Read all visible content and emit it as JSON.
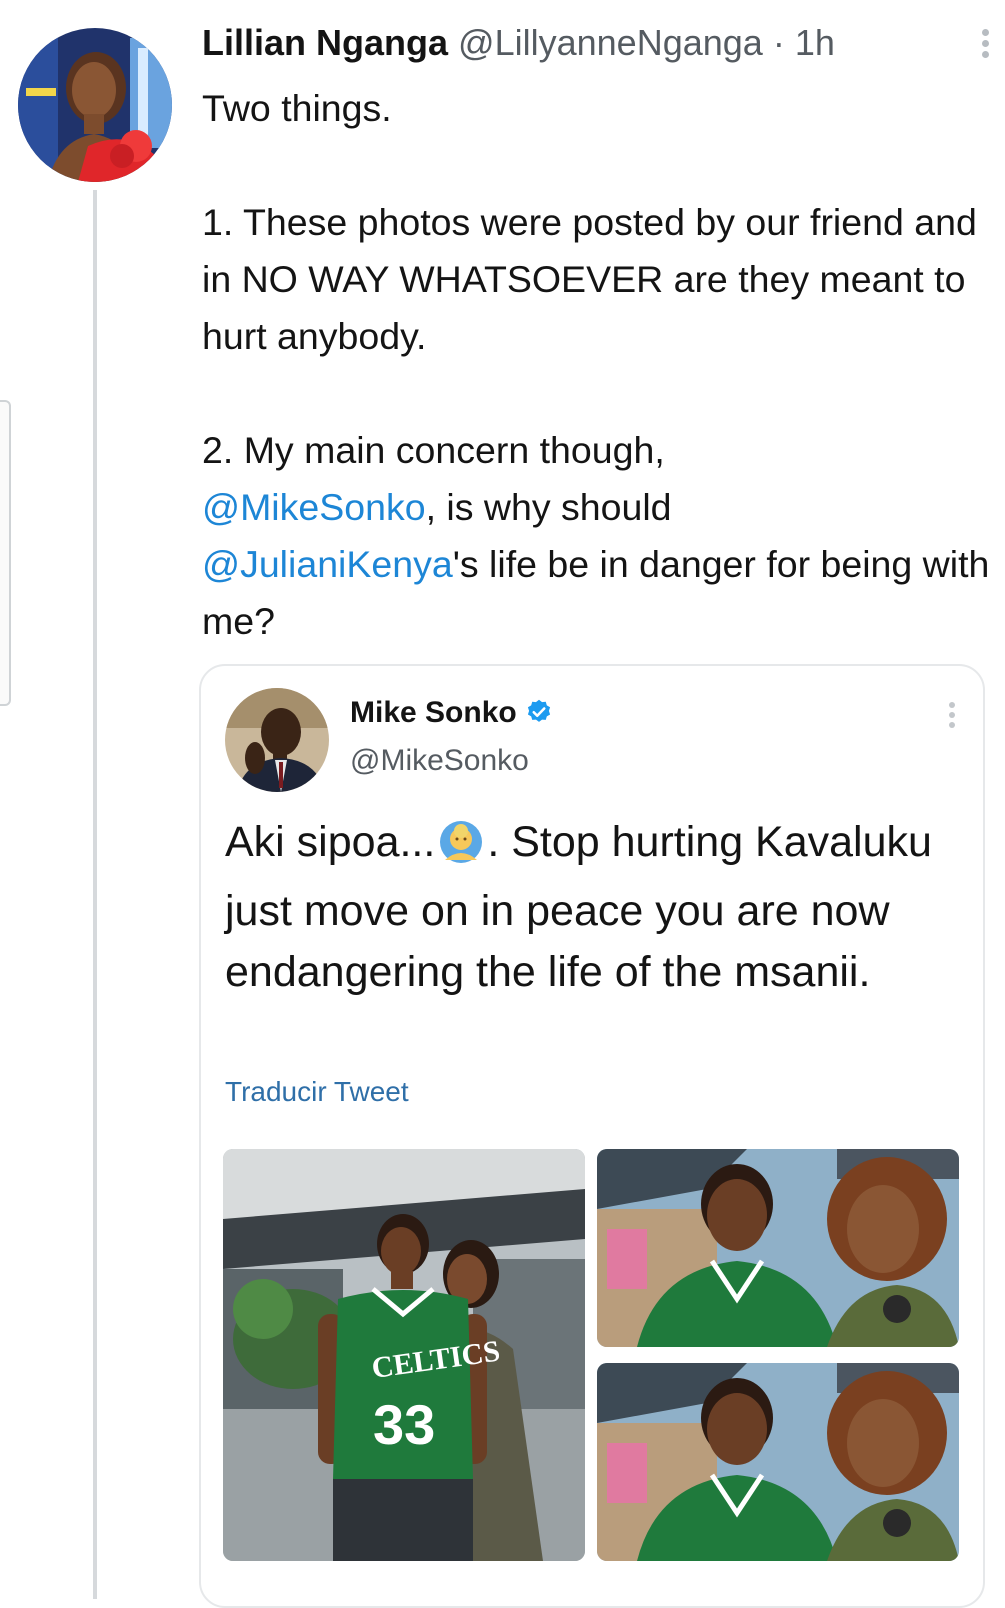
{
  "tweet": {
    "author_name": "Lillian Nganga",
    "author_handle": "@LillyanneNganga",
    "separator": "·",
    "time": "1h",
    "line_intro": "Two things.",
    "point1": "1. These photos were posted by our friend and in NO WAY WHATSOEVER are they meant to hurt anybody.",
    "point2_prefix": "2. My main concern though,",
    "mention1": "@MikeSonko",
    "point2_middle": ", is why should",
    "mention2": "@JulianiKenya",
    "point2_suffix": "'s life be in danger for being with me?",
    "more_icon": "more-vertical-icon"
  },
  "quote": {
    "author_name": "Mike Sonko",
    "author_handle": "@MikeSonko",
    "verified_icon": "verified-badge-icon",
    "text_before_emoji": "Aki sipoa...",
    "emoji": "person-gesturing-ok-emoji",
    "text_after_emoji": ". Stop hurting Kavaluku just move on in peace you are now endangering the life of the msanii.",
    "translate_label": "Traducir Tweet",
    "more_icon": "more-vertical-icon"
  },
  "media": {
    "jersey_text": "CELTICS",
    "jersey_number": "33"
  },
  "colors": {
    "mention": "#1d86d6",
    "verified": "#1d9bf0",
    "translate_link": "#2f6fa8",
    "secondary_text": "#555b61",
    "jersey_green": "#1f7a3c"
  }
}
